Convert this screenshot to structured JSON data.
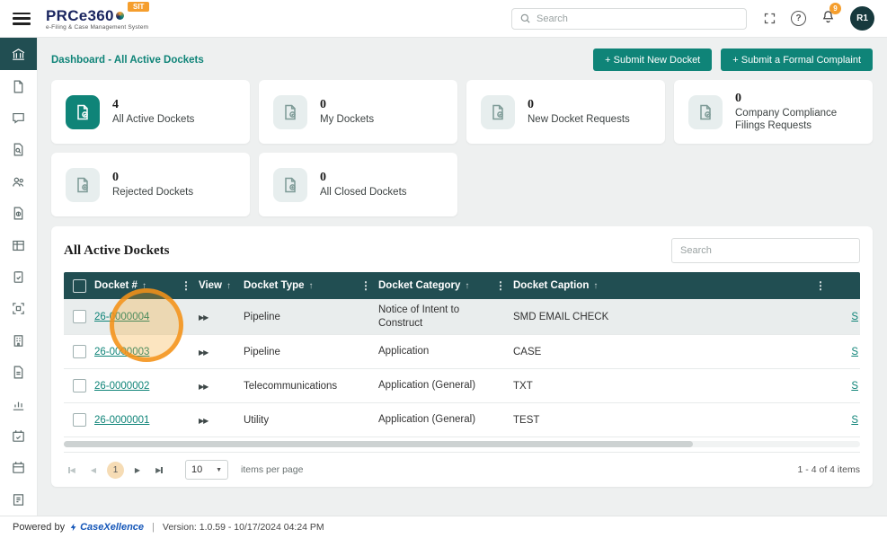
{
  "colors": {
    "accent_teal": "#0F8478",
    "table_header_teal": "#214E52",
    "badge_orange": "#F59E2D",
    "annotation_orange": "#F6A21E",
    "brand_navy": "#1B2660"
  },
  "topbar": {
    "brand": "PRCe360",
    "tagline": "e-Filing & Case Management System",
    "env_badge": "SIT",
    "search_placeholder": "Search",
    "notification_count": "9",
    "avatar_initials": "R1"
  },
  "breadcrumb": "Dashboard - All Active Dockets",
  "actions": {
    "submit_new_docket": "+ Submit New Docket",
    "submit_formal_complaint": "+ Submit a Formal Complaint"
  },
  "stats": [
    {
      "count": "4",
      "label": "All Active Dockets"
    },
    {
      "count": "0",
      "label": "My Dockets"
    },
    {
      "count": "0",
      "label": "New Docket Requests"
    },
    {
      "count": "0",
      "label": "Company Compliance Filings Requests"
    },
    {
      "count": "0",
      "label": "Rejected Dockets"
    },
    {
      "count": "0",
      "label": "All Closed Dockets"
    }
  ],
  "grid": {
    "title": "All Active Dockets",
    "search_placeholder": "Search",
    "headers": {
      "docket": "Docket #",
      "view": "View",
      "type": "Docket Type",
      "category": "Docket Category",
      "caption": "Docket Caption"
    },
    "rows": [
      {
        "docket": "26-0000004",
        "type": "Pipeline",
        "category": "Notice of Intent to Construct",
        "caption": "SMD EMAIL CHECK",
        "side_link": "S"
      },
      {
        "docket": "26-0000003",
        "type": "Pipeline",
        "category": "Application",
        "caption": "CASE",
        "side_link": "S"
      },
      {
        "docket": "26-0000002",
        "type": "Telecommunications",
        "category": "Application (General)",
        "caption": "TXT",
        "side_link": "S"
      },
      {
        "docket": "26-0000001",
        "type": "Utility",
        "category": "Application (General)",
        "caption": "TEST",
        "side_link": "S"
      }
    ],
    "pagination": {
      "page": "1",
      "page_size": "10",
      "items_per_page_label": "items per page",
      "range_label": "1 - 4 of 4 items"
    }
  },
  "icons": {
    "sort": "↑",
    "kebab": "⋮",
    "fast_forward": "▶▶",
    "prev": "◀",
    "next": "▶",
    "caret_down": "▼",
    "help": "?"
  },
  "footer": {
    "powered_by": "Powered by",
    "brand": "CaseXellence",
    "separator": "|",
    "version": "Version: 1.0.59 - 10/17/2024 04:24 PM"
  }
}
